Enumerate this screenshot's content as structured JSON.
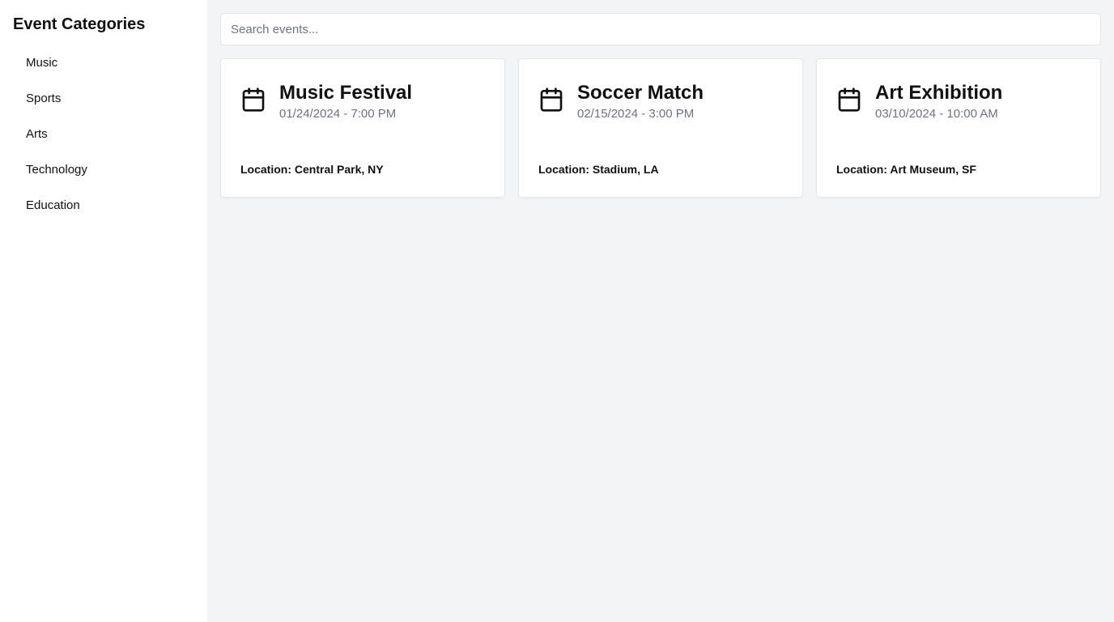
{
  "sidebar": {
    "title": "Event Categories",
    "categories": [
      {
        "label": "Music"
      },
      {
        "label": "Sports"
      },
      {
        "label": "Arts"
      },
      {
        "label": "Technology"
      },
      {
        "label": "Education"
      }
    ]
  },
  "search": {
    "placeholder": "Search events...",
    "value": ""
  },
  "events": [
    {
      "icon": "calendar-icon",
      "title": "Music Festival",
      "datetime": "01/24/2024 - 7:00 PM",
      "location": "Location: Central Park, NY"
    },
    {
      "icon": "calendar-icon",
      "title": "Soccer Match",
      "datetime": "02/15/2024 - 3:00 PM",
      "location": "Location: Stadium, LA"
    },
    {
      "icon": "calendar-icon",
      "title": "Art Exhibition",
      "datetime": "03/10/2024 - 10:00 AM",
      "location": "Location: Art Museum, SF"
    }
  ],
  "colors": {
    "background": "#f3f4f6",
    "surface": "#ffffff",
    "text": "#111111",
    "muted_text": "#6b7280",
    "border": "#e5e7eb"
  }
}
